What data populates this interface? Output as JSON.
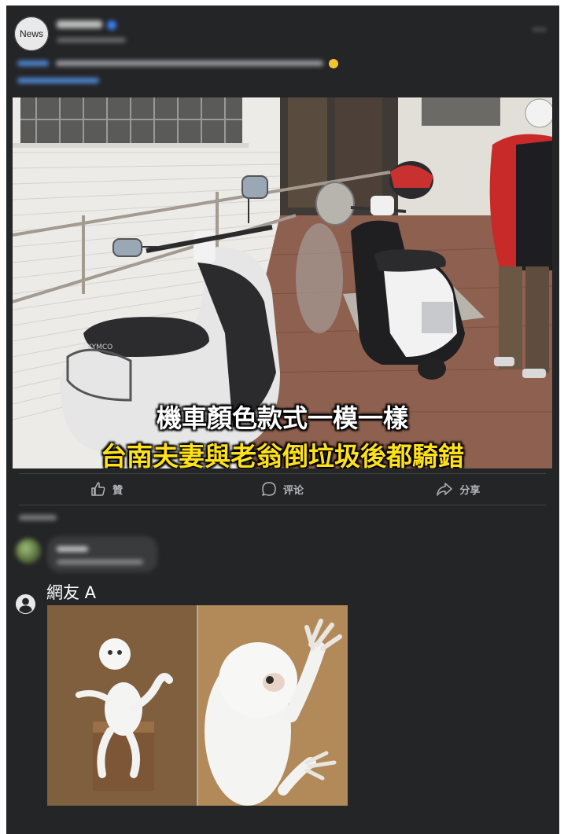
{
  "post": {
    "avatar_text": "News",
    "page_name": "",
    "meta": "",
    "caption_link": "",
    "caption_text": "",
    "caption_link_2": ""
  },
  "photo": {
    "headline_line1": "機車顏色款式一模一樣",
    "headline_line2": "台南夫妻與老翁倒垃圾後都騎錯",
    "scooter_brand": "KYMCO"
  },
  "actions": [
    {
      "label": "贊",
      "icon": "thumbs-up-icon"
    },
    {
      "label": "评论",
      "icon": "comment-icon"
    },
    {
      "label": "分享",
      "icon": "share-icon"
    }
  ],
  "comments": {
    "sort_label": "",
    "first": {
      "name": "",
      "text": ""
    },
    "reply": {
      "name": "網友 A",
      "avatar_icon": "user-icon"
    }
  },
  "colors": {
    "card_bg": "#242526",
    "headline_white": "#ffffff",
    "headline_yellow": "#ffe11a",
    "action_text": "#b0b3b8"
  }
}
